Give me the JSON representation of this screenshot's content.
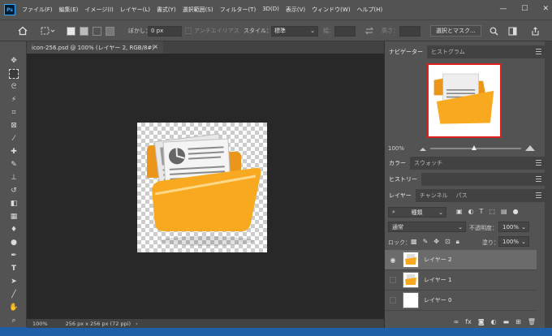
{
  "app": {
    "logo_text": "Ps"
  },
  "menu": [
    "ファイル(F)",
    "編集(E)",
    "イメージ(I)",
    "レイヤー(L)",
    "書式(Y)",
    "選択範囲(S)",
    "フィルター(T)",
    "3D(D)",
    "表示(V)",
    "ウィンドウ(W)",
    "ヘルプ(H)"
  ],
  "window_controls": {
    "minimize": "—",
    "maximize": "☐",
    "close": "✕"
  },
  "options": {
    "feather_label": "ぼかし：",
    "feather_value": "0 px",
    "antialias_label": "アンチエイリアス",
    "style_label": "スタイル：",
    "style_value": "標準",
    "width_label": "幅：",
    "height_label": "高さ：",
    "select_mask_button": "選択とマスク..."
  },
  "document": {
    "tab_title": "icon-256.psd @ 100% (レイヤー 2, RGB/8#)",
    "tab_close": "×"
  },
  "status": {
    "zoom": "100%",
    "doc_info": "256 px x 256 px (72 ppi)",
    "arrow": "›"
  },
  "navigator": {
    "tabs": [
      "ナビゲーター",
      "ヒストグラム"
    ],
    "zoom": "100%"
  },
  "color_panel": {
    "tabs": [
      "カラー",
      "スウォッチ"
    ]
  },
  "history_panel": {
    "tabs": [
      "ヒストリー"
    ]
  },
  "layers_panel": {
    "tabs": [
      "レイヤー",
      "チャンネル",
      "パス"
    ],
    "filter_kind": "種類",
    "blend_mode": "通常",
    "opacity_label": "不透明度：",
    "opacity_value": "100%",
    "lock_label": "ロック：",
    "fill_label": "塗り：",
    "fill_value": "100%",
    "layers": [
      {
        "name": "レイヤー 2",
        "visible": true,
        "selected": true
      },
      {
        "name": "レイヤー 1",
        "visible": false,
        "selected": false
      },
      {
        "name": "レイヤー 0",
        "visible": false,
        "selected": false
      }
    ]
  },
  "colors": {
    "accent_blue": "#31a8ff",
    "panel_bg": "#535353",
    "canvas_bg": "#282828",
    "folder_orange": "#f8a91f",
    "navigator_frame": "#e02020"
  }
}
